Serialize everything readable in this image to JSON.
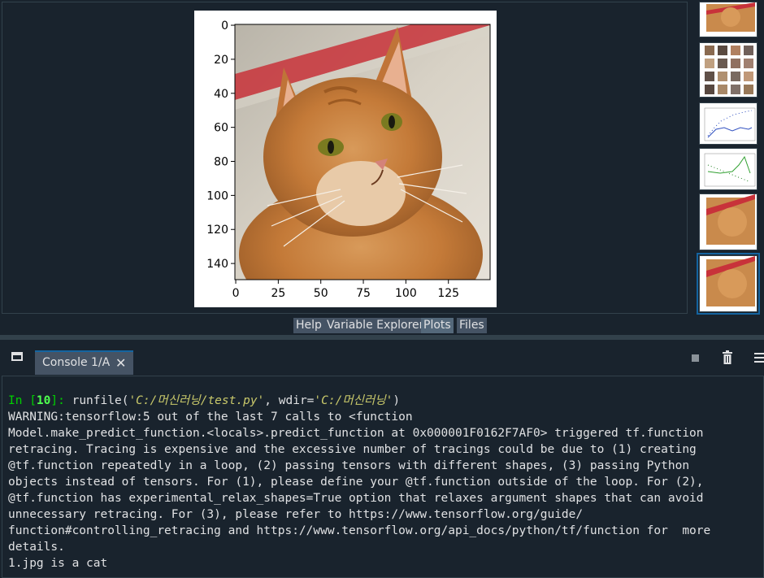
{
  "plot": {
    "y_ticks": [
      "0",
      "20",
      "40",
      "60",
      "80",
      "100",
      "120",
      "140"
    ],
    "x_ticks": [
      "0",
      "25",
      "50",
      "75",
      "100",
      "125"
    ]
  },
  "pane_tabs": [
    "Help",
    "Variable Explorer",
    "Plots",
    "Files"
  ],
  "active_pane_tab": "Plots",
  "console": {
    "tab_label": "Console 1/A",
    "close_glyph": "✕",
    "prompt_label": "In [",
    "prompt_number": "10",
    "prompt_end": "]:",
    "command_prefix": " runfile(",
    "arg1": "'C:/머신러닝/test.py'",
    "mid": ", wdir=",
    "arg2": "'C:/머신러닝'",
    "command_suffix": ")",
    "output_lines": [
      "WARNING:tensorflow:5 out of the last 7 calls to <function",
      "Model.make_predict_function.<locals>.predict_function at 0x000001F0162F7AF0> triggered tf.function",
      "retracing. Tracing is expensive and the excessive number of tracings could be due to (1) creating",
      "@tf.function repeatedly in a loop, (2) passing tensors with different shapes, (3) passing Python",
      "objects instead of tensors. For (1), please define your @tf.function outside of the loop. For (2),",
      "@tf.function has experimental_relax_shapes=True option that relaxes argument shapes that can avoid",
      "unnecessary retracing. For (3), please refer to https://www.tensorflow.org/guide/",
      "function#controlling_retracing and https://www.tensorflow.org/api_docs/python/tf/function for  more",
      "details.",
      "1.jpg is a cat"
    ]
  },
  "icons": {
    "console_window": "window-icon",
    "stop": "stop-icon",
    "clear": "trash-icon",
    "options": "menu-icon"
  }
}
